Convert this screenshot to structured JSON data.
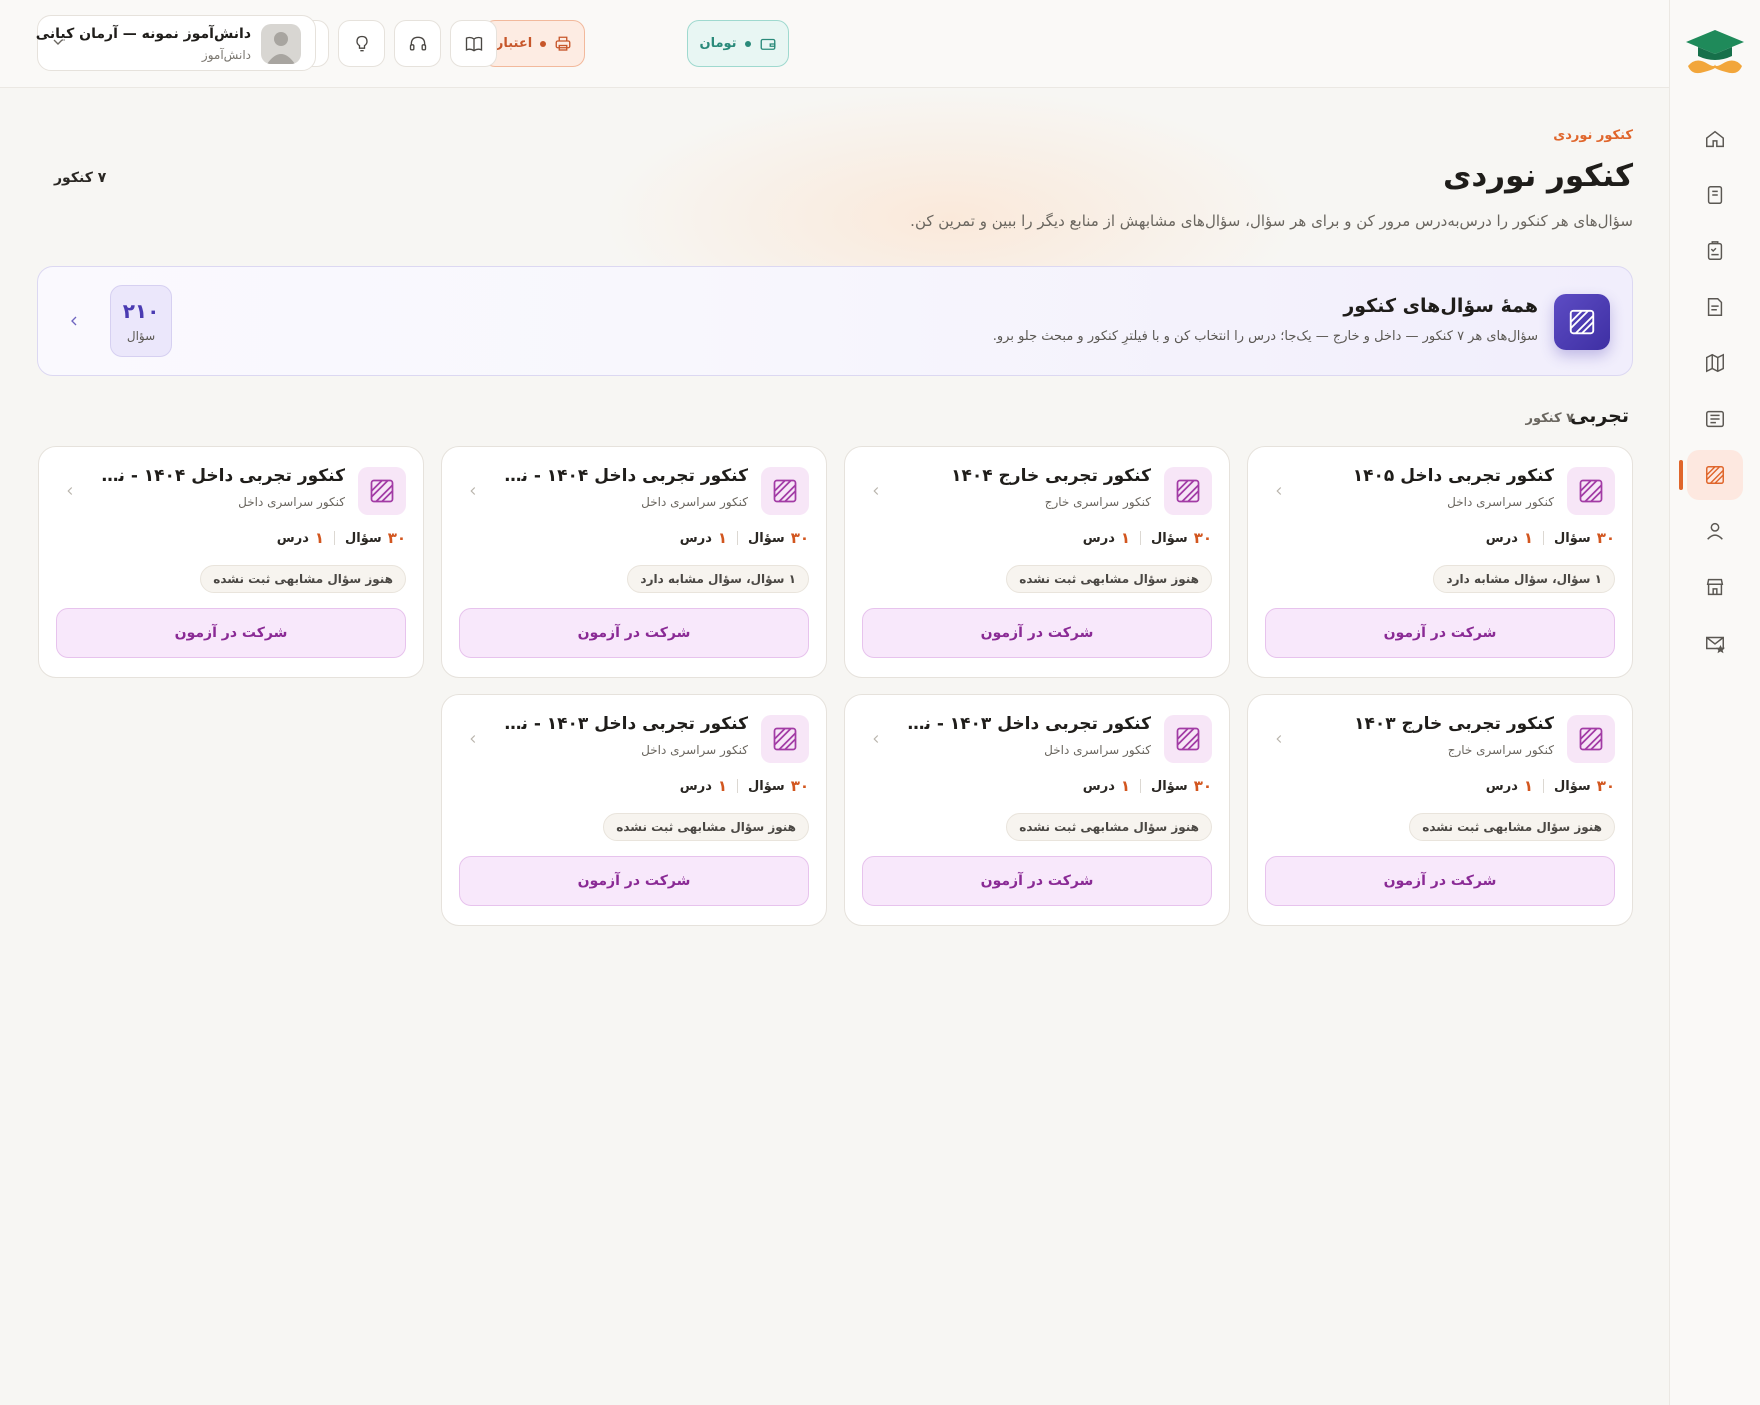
{
  "topbar": {
    "wallet_label": "تومان",
    "credit_label": "اعتبار",
    "user_name": "دانش‌آموز نمونه — آرمان کیانی",
    "user_role": "دانش‌آموز"
  },
  "header": {
    "breadcrumb": "کنکور نوردی",
    "title": "کنکور نوردی",
    "subtitle": "سؤال‌های هر کنکور را درس‌به‌درس مرور کن و برای هر سؤال، سؤال‌های مشابهش از منابع دیگر را ببین و تمرین کن.",
    "count": "۷ کنکور"
  },
  "banner": {
    "title": "همهٔ سؤال‌های کنکور",
    "subtitle": "سؤال‌های هر ۷ کنکور — داخل و خارج — یک‌جا؛ درس را انتخاب کن و با فیلترِ کنکور و مبحث جلو برو.",
    "count": "۲۱۰",
    "count_label": "سؤال"
  },
  "section": {
    "title": "تجربی",
    "count": "۷ کنکور"
  },
  "labels": {
    "questions": "سؤال",
    "lessons": "درس",
    "join": "شرکت در آزمون"
  },
  "cards": [
    {
      "title": "کنکور تجربی داخل ۱۴۰۵",
      "type": "کنکور سراسری داخل",
      "questions": "۳۰",
      "lessons": "۱",
      "badge": "۱ سؤال، سؤال مشابه دارد"
    },
    {
      "title": "کنکور تجربی خارج ۱۴۰۴",
      "type": "کنکور سراسری خارج",
      "questions": "۳۰",
      "lessons": "۱",
      "badge": "هنوز سؤال مشابهی ثبت نشده"
    },
    {
      "title": "کنکور تجربی داخل ۱۴۰۴ - نوبت ...",
      "type": "کنکور سراسری داخل",
      "questions": "۳۰",
      "lessons": "۱",
      "badge": "۱ سؤال، سؤال مشابه دارد"
    },
    {
      "title": "کنکور تجربی داخل ۱۴۰۴ - نوبت ...",
      "type": "کنکور سراسری داخل",
      "questions": "۳۰",
      "lessons": "۱",
      "badge": "هنوز سؤال مشابهی ثبت نشده"
    },
    {
      "title": "کنکور تجربی خارج ۱۴۰۳",
      "type": "کنکور سراسری خارج",
      "questions": "۳۰",
      "lessons": "۱",
      "badge": "هنوز سؤال مشابهی ثبت نشده"
    },
    {
      "title": "کنکور تجربی داخل ۱۴۰۳ - نوبت ...",
      "type": "کنکور سراسری داخل",
      "questions": "۳۰",
      "lessons": "۱",
      "badge": "هنوز سؤال مشابهی ثبت نشده"
    },
    {
      "title": "کنکور تجربی داخل ۱۴۰۳ - نوبت ...",
      "type": "کنکور سراسری داخل",
      "questions": "۳۰",
      "lessons": "۱",
      "badge": "هنوز سؤال مشابهی ثبت نشده"
    }
  ],
  "icons": {
    "logo": "graduation-cap-mustache-icon",
    "nav": [
      "home-icon",
      "book-icon",
      "clipboard-check-icon",
      "document-icon",
      "map-icon",
      "newspaper-icon",
      "konkur-grid-icon",
      "user-icon",
      "store-icon",
      "mail-star-icon"
    ]
  },
  "colors": {
    "accent": "#e0662c",
    "banner_accent": "#4a3bb2",
    "card_button": "#8a2a95",
    "wallet": "#2a8a7a"
  }
}
